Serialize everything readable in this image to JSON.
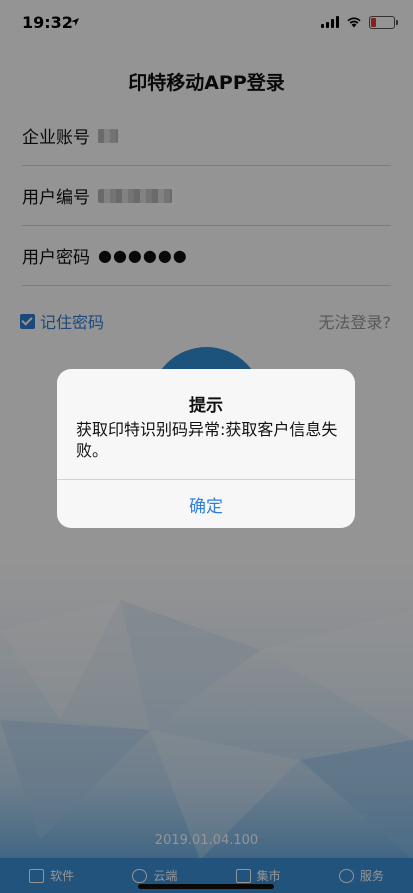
{
  "status_bar": {
    "time": "19:32",
    "location_icon": "location-arrow-icon",
    "battery_color": "#e53935"
  },
  "login": {
    "title": "印特移动APP登录",
    "company_label": "企业账号",
    "user_label": "用户编号",
    "password_label": "用户密码",
    "password_value": "●●●●●●",
    "remember_label": "记住密码",
    "remember_checked": true,
    "forgot_link": "无法登录?",
    "accent_color": "#2f7fd6"
  },
  "footer": {
    "version": "2019.01.04.100",
    "tabs": [
      {
        "label": "软件",
        "icon": "software-icon"
      },
      {
        "label": "云端",
        "icon": "cloud-icon"
      },
      {
        "label": "集市",
        "icon": "market-icon"
      },
      {
        "label": "服务",
        "icon": "service-icon"
      }
    ]
  },
  "alert": {
    "title": "提示",
    "message": "获取印特识别码异常:获取客户信息失败。",
    "confirm_label": "确定"
  }
}
